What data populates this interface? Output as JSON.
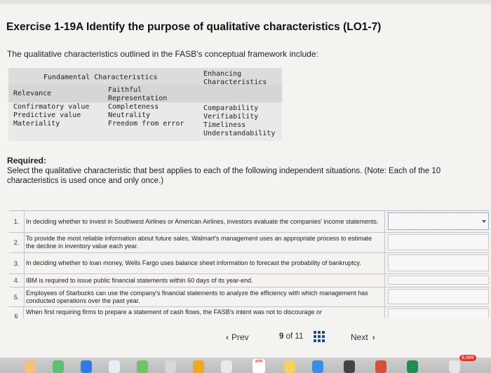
{
  "title": "Exercise 1-19A Identify the purpose of qualitative characteristics (LO1-7)",
  "intro": "The qualitative characteristics outlined in the FASB's conceptual framework include:",
  "characteristics_table": {
    "fundamental_header": "Fundamental Characteristics",
    "enhancing_header_line1": "Enhancing",
    "enhancing_header_line2": "Characteristics",
    "relevance": "Relevance",
    "faithful_line1": "Faithful",
    "faithful_line2": "Representation",
    "relevance_items": [
      "Confirmatory value",
      "Predictive value",
      "Materiality"
    ],
    "faithful_items": [
      "Completeness",
      "Neutrality",
      "Freedom from error"
    ],
    "enhancing_items": [
      "Comparability",
      "Verifiability",
      "Timeliness",
      "Understandability"
    ]
  },
  "required": {
    "heading": "Required:",
    "text": "Select the qualitative characteristic that best applies to each of the following independent situations. (Note: Each of the 10 characteristics is used once and only once.)"
  },
  "situations": [
    {
      "num": "1.",
      "text": "In deciding whether to invest in Southwest Airlines or American Airlines, investors evaluate the companies' income statements."
    },
    {
      "num": "2.",
      "text": "To provide the most reliable information about future sales, Walmart's management uses an appropriate process to estimate the decline in inventory value each year."
    },
    {
      "num": "3.",
      "text": "In deciding whether to loan money, Wells Fargo uses balance sheet information to forecast the probability of bankruptcy."
    },
    {
      "num": "4.",
      "text": "IBM is required to issue public financial statements within 60 days of its year-end."
    },
    {
      "num": "5.",
      "text": "Employees of Starbucks can use the company's financial statements to analyze the efficiency with which management has conducted operations over the past year."
    },
    {
      "num": "6",
      "text": "When first requiring firms to prepare a statement of cash flows, the FASB's intent was not to discourage or"
    }
  ],
  "pager": {
    "prev_label": "Prev",
    "current": "9",
    "of_label": "of",
    "total": "11",
    "next_label": "Next"
  },
  "dock": {
    "calendar_month": "APR",
    "badge_count": "8,589"
  },
  "colors": {
    "accent": "#1e4b8f",
    "badge": "#e0352b"
  }
}
